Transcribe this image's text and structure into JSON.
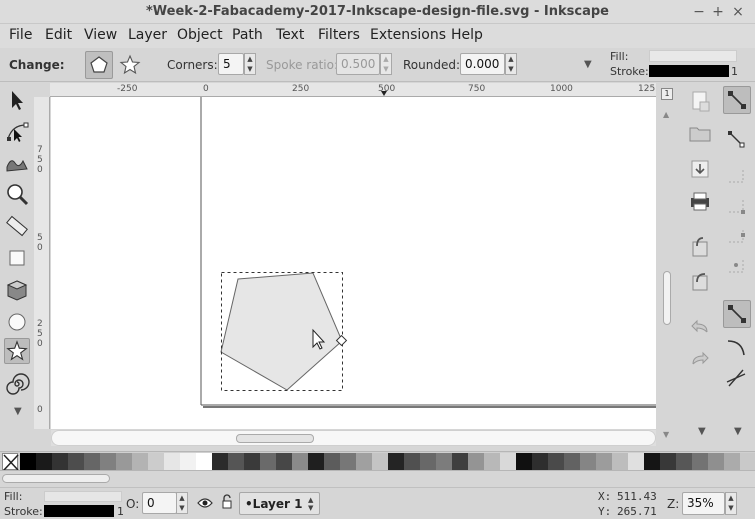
{
  "window": {
    "title": "*Week-2-Fabacademy-2017-Inkscape-design-file.svg - Inkscape",
    "minimize": "−",
    "maximize": "+",
    "close": "×"
  },
  "menu": [
    "File",
    "Edit",
    "View",
    "Layer",
    "Object",
    "Path",
    "Text",
    "Filters",
    "Extensions",
    "Help"
  ],
  "controls": {
    "change_label": "Change:",
    "corners_label": "Corners:",
    "corners_value": "5",
    "spoke_label": "Spoke ratio:",
    "spoke_value": "0.500",
    "rounded_label": "Rounded:",
    "rounded_value": "0.000",
    "fill_label": "Fill:",
    "stroke_label": "Stroke:",
    "stroke_width": "1"
  },
  "rulers": {
    "top_labels": [
      "-250",
      "0",
      "250",
      "500",
      "750",
      "1000",
      "125"
    ],
    "left_labels": [
      "7",
      "5",
      "0",
      "5",
      "0",
      "2",
      "5",
      "0",
      "0"
    ]
  },
  "status": {
    "fill_label": "Fill:",
    "stroke_label": "Stroke:",
    "stroke_width": "1",
    "opacity_label": "O:",
    "opacity_value": "0",
    "layer_name": "•Layer 1",
    "x_label": "X:",
    "x_value": "511.43",
    "y_label": "Y:",
    "y_value": "265.71",
    "zoom_label": "Z:",
    "zoom_value": "35%"
  },
  "palette_colors": [
    "#000000",
    "#1a1a1a",
    "#333333",
    "#4d4d4d",
    "#666666",
    "#808080",
    "#999999",
    "#b3b3b3",
    "#cccccc",
    "#e6e6e6",
    "#f2f2f2",
    "#ffffff",
    "#2b2b2b",
    "#555555",
    "#3a3a3a",
    "#6a6a6a",
    "#474747",
    "#8a8a8a",
    "#1f1f1f",
    "#5c5c5c",
    "#777777",
    "#a0a0a0",
    "#c4c4c4",
    "#242424",
    "#505050",
    "#686868",
    "#7c7c7c",
    "#3f3f3f",
    "#949494",
    "#b8b8b8",
    "#d9d9d9",
    "#101010",
    "#2e2e2e",
    "#4a4a4a",
    "#626262",
    "#858585",
    "#9c9c9c",
    "#bdbdbd",
    "#e0e0e0",
    "#151515",
    "#383838",
    "#575757",
    "#737373",
    "#8f8f8f",
    "#ababab",
    "#c9c9c9"
  ]
}
